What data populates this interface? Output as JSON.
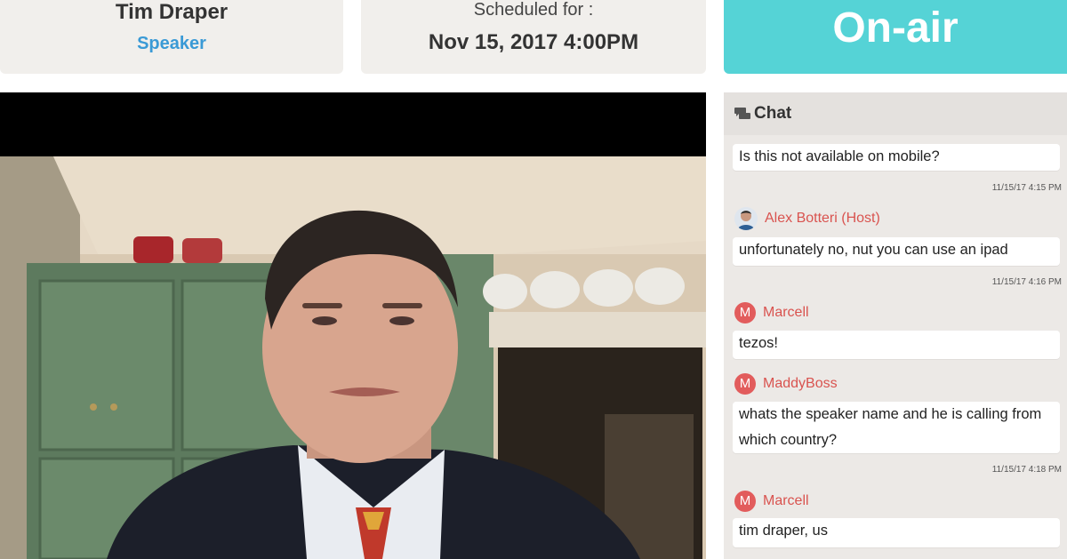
{
  "speaker": {
    "name": "Tim Draper",
    "role": "Speaker"
  },
  "schedule": {
    "label": "Scheduled for :",
    "datetime": "Nov 15, 2017 4:00PM"
  },
  "status": {
    "label": "On-air",
    "color": "#55d3d6"
  },
  "chat": {
    "title": "Chat",
    "icon": "chat-bubbles-icon",
    "messages": [
      {
        "author": "",
        "text": "Is this not available on mobile?",
        "time": "11/15/17 4:15 PM"
      },
      {
        "author": "Alex Botteri (Host)",
        "avatar": "photo",
        "text": "unfortunately no, nut you can use an ipad",
        "time": "11/15/17 4:16 PM"
      },
      {
        "author": "Marcell",
        "avatar": "M",
        "text": "tezos!",
        "time": ""
      },
      {
        "author": "MaddyBoss",
        "avatar": "M",
        "text_line1": "whats the speaker name and he is calling from",
        "text_line2": "which country?",
        "time": "11/15/17 4:18 PM"
      },
      {
        "author": "Marcell",
        "avatar": "M",
        "text": "tim draper, us",
        "time": ""
      }
    ]
  }
}
